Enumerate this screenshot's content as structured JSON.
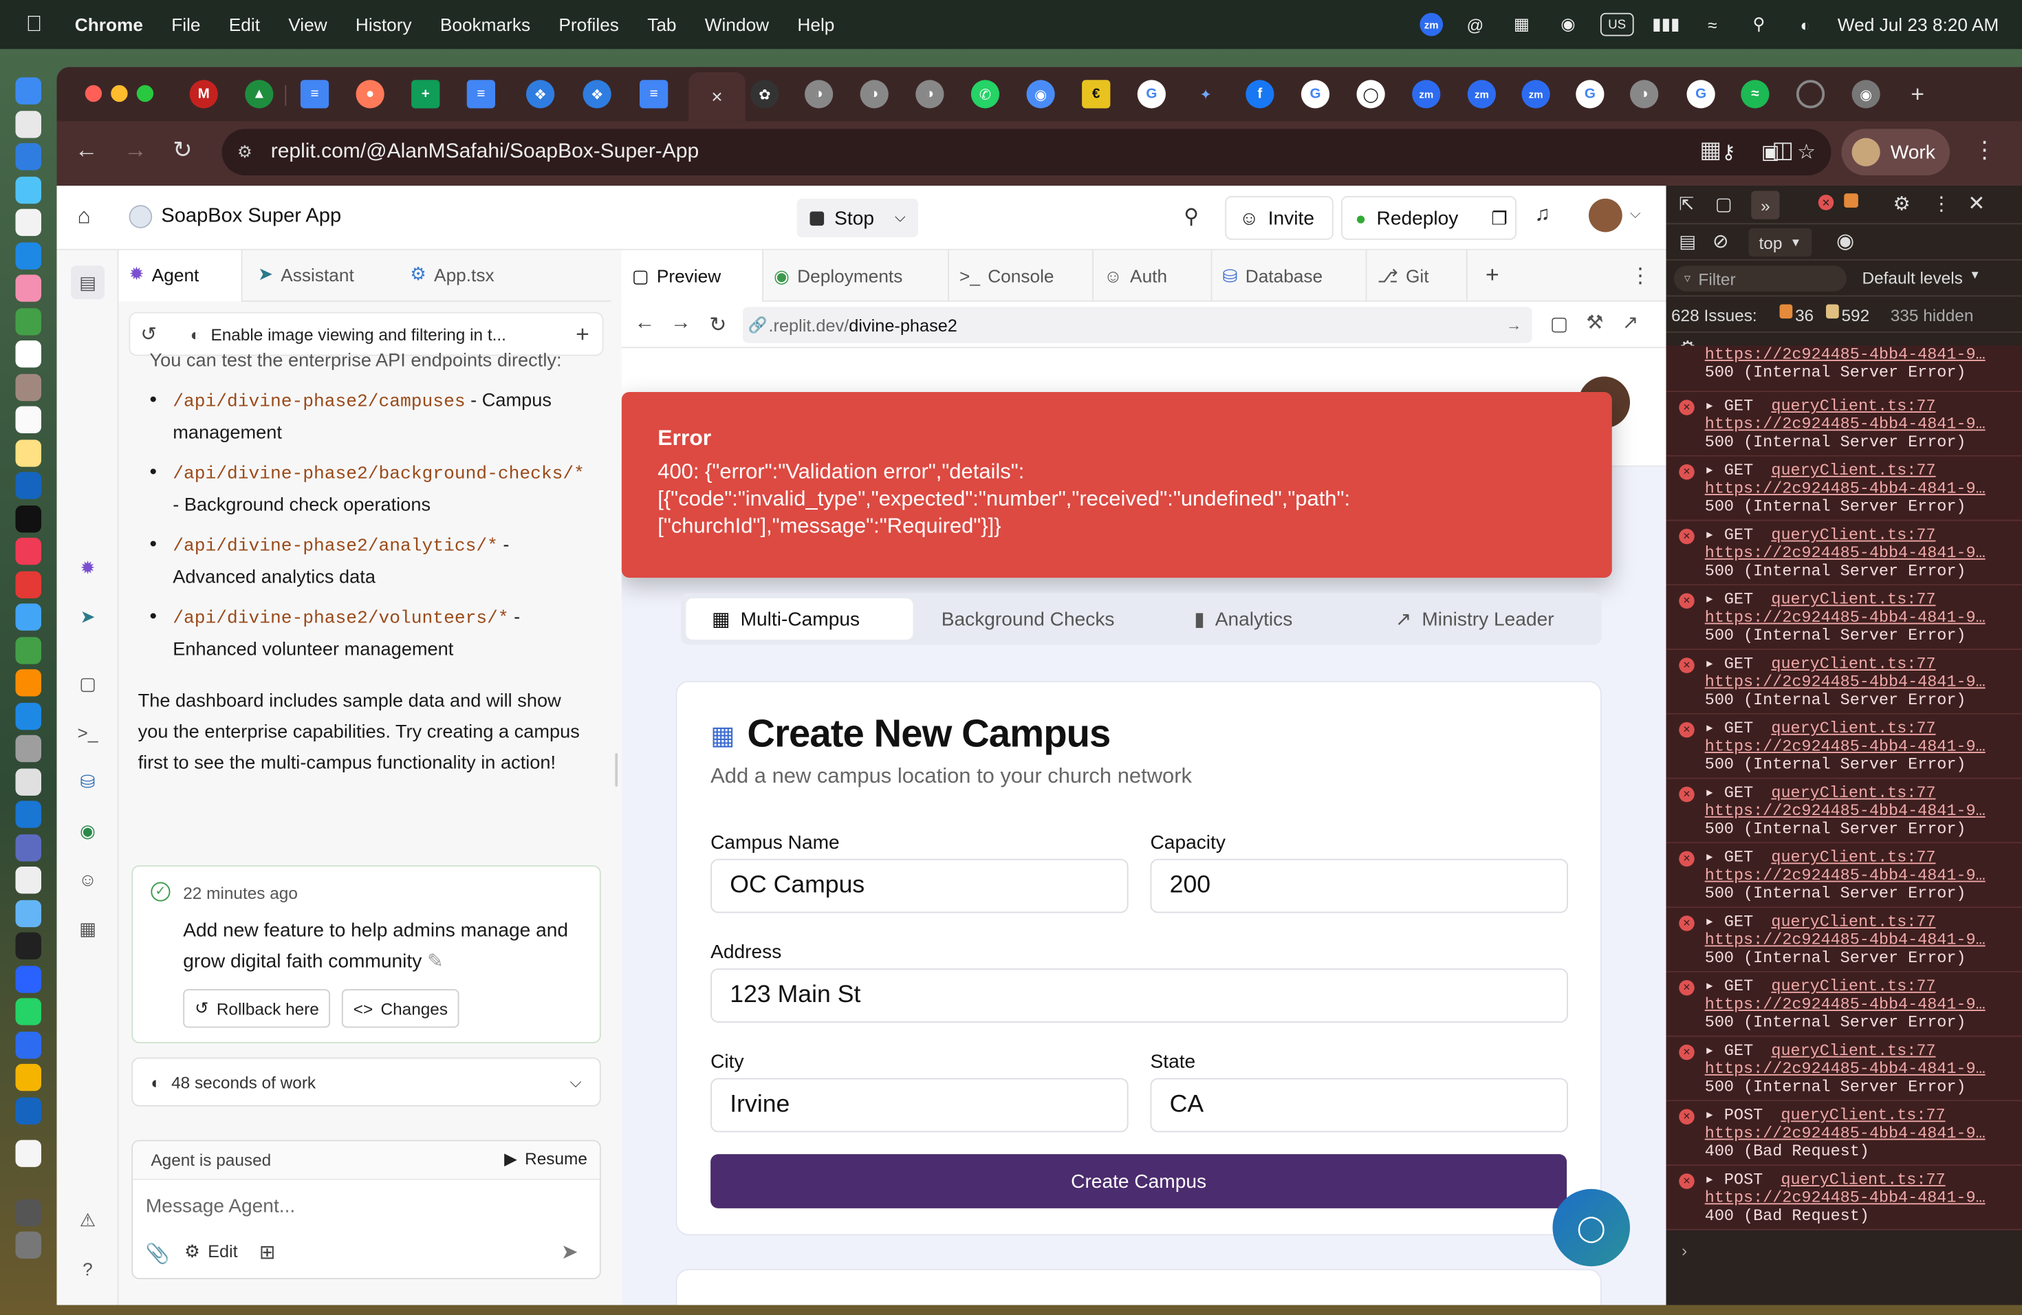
{
  "menubar": {
    "app": "Chrome",
    "items": [
      "File",
      "Edit",
      "View",
      "History",
      "Bookmarks",
      "Profiles",
      "Tab",
      "Window",
      "Help"
    ],
    "status_lang": "US",
    "clock": "Wed Jul 23  8:20 AM"
  },
  "browser": {
    "url": "replit.com/@AlanMSafahi/SoapBox-Super-App",
    "profile": "Work",
    "active_tab_close": "×",
    "new_tab": "+"
  },
  "app": {
    "title": "SoapBox Super App",
    "stop_label": "Stop",
    "invite_label": "Invite",
    "redeploy_label": "Redeploy"
  },
  "left_tabs": [
    "Agent",
    "Assistant",
    "App.tsx"
  ],
  "chat": {
    "thread_title": "Enable image viewing and filtering in t...",
    "intro": "You can test the enterprise API endpoints directly:",
    "endpoints": [
      {
        "path": "/api/divine-phase2/campuses",
        "desc": "- Campus management"
      },
      {
        "path": "/api/divine-phase2/background-checks/*",
        "desc": "- Background check operations"
      },
      {
        "path": "/api/divine-phase2/analytics/*",
        "desc": "- Advanced analytics data"
      },
      {
        "path": "/api/divine-phase2/volunteers/*",
        "desc": "- Enhanced volunteer management"
      }
    ],
    "summary": "The dashboard includes sample data and will show you the enterprise capabilities. Try creating a campus first to see the multi-campus functionality in action!",
    "checkpoint_time": "22 minutes ago",
    "checkpoint_text": "Add new feature to help admins manage and grow digital faith community",
    "rollback_label": "Rollback here",
    "changes_label": "Changes",
    "work_time": "48 seconds of work",
    "paused_label": "Agent is paused",
    "resume_label": "Resume",
    "message_placeholder": "Message Agent...",
    "edit_label": "Edit"
  },
  "right_tabs": [
    "Preview",
    "Deployments",
    "Console",
    "Auth",
    "Database",
    "Git"
  ],
  "preview": {
    "url_prefix": ".replit.dev/",
    "url_path": "divine-phase2",
    "error_title": "Error",
    "error_message": "400: {\"error\":\"Validation error\",\"details\": [{\"code\":\"invalid_type\",\"expected\":\"number\",\"received\":\"undefined\",\"path\": [\"churchId\"],\"message\":\"Required\"}]}",
    "subtabs": [
      "Multi-Campus",
      "Background Checks",
      "Analytics",
      "Ministry Leader"
    ],
    "card_title": "Create New Campus",
    "card_subtitle": "Add a new campus location to your church network",
    "fields": {
      "campus_name": {
        "label": "Campus Name",
        "value": "OC Campus"
      },
      "capacity": {
        "label": "Capacity",
        "value": "200"
      },
      "address": {
        "label": "Address",
        "value": "123 Main St"
      },
      "city": {
        "label": "City",
        "value": "Irvine"
      },
      "state": {
        "label": "State",
        "value": "CA"
      }
    },
    "submit_label": "Create Campus"
  },
  "devtools": {
    "context": "top",
    "filter_placeholder": "Filter",
    "levels": "Default levels",
    "issues_label": "628 Issues:",
    "issues_errors": "36",
    "issues_warnings": "592",
    "hidden": "335 hidden",
    "logs": [
      {
        "method": "",
        "source": "",
        "url": "https://2c924485-4bb4-4841-9…",
        "status": "500 (Internal Server Error)"
      },
      {
        "method": "GET",
        "source": "queryClient.ts:77",
        "url": "https://2c924485-4bb4-4841-9…",
        "status": "500 (Internal Server Error)"
      },
      {
        "method": "GET",
        "source": "queryClient.ts:77",
        "url": "https://2c924485-4bb4-4841-9…",
        "status": "500 (Internal Server Error)"
      },
      {
        "method": "GET",
        "source": "queryClient.ts:77",
        "url": "https://2c924485-4bb4-4841-9…",
        "status": "500 (Internal Server Error)"
      },
      {
        "method": "GET",
        "source": "queryClient.ts:77",
        "url": "https://2c924485-4bb4-4841-9…",
        "status": "500 (Internal Server Error)"
      },
      {
        "method": "GET",
        "source": "queryClient.ts:77",
        "url": "https://2c924485-4bb4-4841-9…",
        "status": "500 (Internal Server Error)"
      },
      {
        "method": "GET",
        "source": "queryClient.ts:77",
        "url": "https://2c924485-4bb4-4841-9…",
        "status": "500 (Internal Server Error)"
      },
      {
        "method": "GET",
        "source": "queryClient.ts:77",
        "url": "https://2c924485-4bb4-4841-9…",
        "status": "500 (Internal Server Error)"
      },
      {
        "method": "GET",
        "source": "queryClient.ts:77",
        "url": "https://2c924485-4bb4-4841-9…",
        "status": "500 (Internal Server Error)"
      },
      {
        "method": "GET",
        "source": "queryClient.ts:77",
        "url": "https://2c924485-4bb4-4841-9…",
        "status": "500 (Internal Server Error)"
      },
      {
        "method": "GET",
        "source": "queryClient.ts:77",
        "url": "https://2c924485-4bb4-4841-9…",
        "status": "500 (Internal Server Error)"
      },
      {
        "method": "GET",
        "source": "queryClient.ts:77",
        "url": "https://2c924485-4bb4-4841-9…",
        "status": "500 (Internal Server Error)"
      },
      {
        "method": "POST",
        "source": "queryClient.ts:77",
        "url": "https://2c924485-4bb4-4841-9…",
        "status": "400 (Bad Request)"
      },
      {
        "method": "POST",
        "source": "queryClient.ts:77",
        "url": "https://2c924485-4bb4-4841-9…",
        "status": "400 (Bad Request)"
      }
    ]
  },
  "colors": {
    "primary_button": "#4b2c6e",
    "error_toast": "#dc4a42",
    "browser_frame": "#3b2626"
  }
}
